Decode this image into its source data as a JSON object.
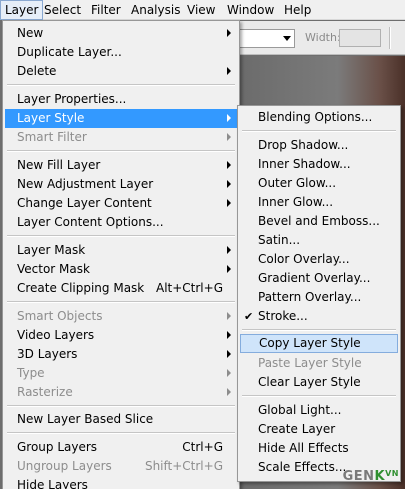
{
  "menubar": {
    "items": [
      {
        "label": "Layer",
        "active": true
      },
      {
        "label": "Select"
      },
      {
        "label": "Filter"
      },
      {
        "label": "Analysis"
      },
      {
        "label": "View"
      },
      {
        "label": "Window"
      },
      {
        "label": "Help"
      }
    ]
  },
  "options_bar": {
    "width_label": "Width:"
  },
  "layer_menu": {
    "items": [
      {
        "label": "New",
        "submenu": true
      },
      {
        "label": "Duplicate Layer..."
      },
      {
        "label": "Delete",
        "submenu": true
      },
      {
        "label": "Layer Properties..."
      },
      {
        "label": "Layer Style",
        "submenu": true,
        "highlighted": true
      },
      {
        "label": "Smart Filter",
        "submenu": true,
        "disabled": true
      },
      {
        "label": "New Fill Layer",
        "submenu": true
      },
      {
        "label": "New Adjustment Layer",
        "submenu": true
      },
      {
        "label": "Change Layer Content",
        "submenu": true
      },
      {
        "label": "Layer Content Options..."
      },
      {
        "label": "Layer Mask",
        "submenu": true
      },
      {
        "label": "Vector Mask",
        "submenu": true
      },
      {
        "label": "Create Clipping Mask",
        "shortcut": "Alt+Ctrl+G"
      },
      {
        "label": "Smart Objects",
        "submenu": true,
        "disabled": true
      },
      {
        "label": "Video Layers",
        "submenu": true
      },
      {
        "label": "3D Layers",
        "submenu": true
      },
      {
        "label": "Type",
        "submenu": true,
        "disabled": true
      },
      {
        "label": "Rasterize",
        "submenu": true,
        "disabled": true
      },
      {
        "label": "New Layer Based Slice"
      },
      {
        "label": "Group Layers",
        "shortcut": "Ctrl+G"
      },
      {
        "label": "Ungroup Layers",
        "shortcut": "Shift+Ctrl+G",
        "disabled": true
      },
      {
        "label": "Hide Layers"
      }
    ]
  },
  "layer_style_menu": {
    "items": [
      {
        "label": "Blending Options..."
      },
      {
        "label": "Drop Shadow..."
      },
      {
        "label": "Inner Shadow..."
      },
      {
        "label": "Outer Glow..."
      },
      {
        "label": "Inner Glow..."
      },
      {
        "label": "Bevel and Emboss..."
      },
      {
        "label": "Satin..."
      },
      {
        "label": "Color Overlay..."
      },
      {
        "label": "Gradient Overlay..."
      },
      {
        "label": "Pattern Overlay..."
      },
      {
        "label": "Stroke...",
        "checked": true,
        "check_mark": "✔"
      },
      {
        "label": "Copy Layer Style",
        "highlighted": true
      },
      {
        "label": "Paste Layer Style",
        "disabled": true
      },
      {
        "label": "Clear Layer Style"
      },
      {
        "label": "Global Light..."
      },
      {
        "label": "Create Layer"
      },
      {
        "label": "Hide All Effects"
      },
      {
        "label": "Scale Effects..."
      }
    ]
  },
  "watermark": {
    "part1": "GEN",
    "part2": "K",
    "part3": "VN"
  },
  "colors": {
    "menu_bg": "#f0f0f0",
    "highlight": "#3399ff",
    "sub_highlight": "#cfe4fa",
    "disabled_text": "#8d8d8d"
  }
}
